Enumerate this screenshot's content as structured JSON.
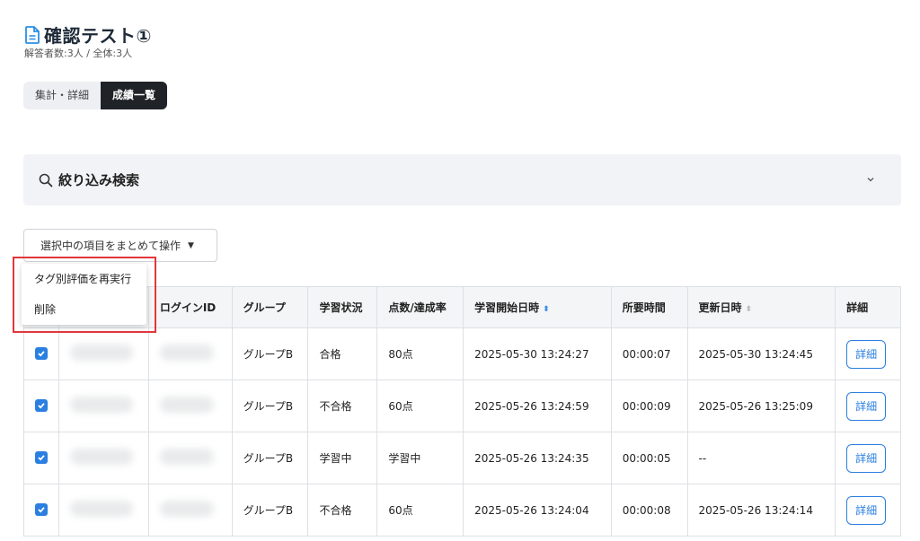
{
  "header": {
    "title": "確認テスト①",
    "subtitle": "解答者数:3人 / 全体:3人"
  },
  "tabs": [
    {
      "label": "集計・詳細",
      "active": false
    },
    {
      "label": "成績一覧",
      "active": true
    }
  ],
  "filter": {
    "label": "絞り込み検索"
  },
  "bulk_action": {
    "label": "選択中の項目をまとめて操作",
    "menu": [
      "タグ別評価を再実行",
      "削除"
    ]
  },
  "table": {
    "headers": [
      "",
      "",
      "ログインID",
      "グループ",
      "学習状況",
      "点数/達成率",
      "学習開始日時",
      "所要時間",
      "更新日時",
      "詳細"
    ],
    "rows": [
      {
        "group": "グループB",
        "status": "合格",
        "score": "80点",
        "start": "2025-05-30 13:24:27",
        "duration": "00:00:07",
        "updated": "2025-05-30 13:24:45",
        "detail": "詳細"
      },
      {
        "group": "グループB",
        "status": "不合格",
        "score": "60点",
        "start": "2025-05-26 13:24:59",
        "duration": "00:00:09",
        "updated": "2025-05-26 13:25:09",
        "detail": "詳細"
      },
      {
        "group": "グループB",
        "status": "学習中",
        "score": "学習中",
        "start": "2025-05-26 13:24:35",
        "duration": "00:00:05",
        "updated": "--",
        "detail": "詳細"
      },
      {
        "group": "グループB",
        "status": "不合格",
        "score": "60点",
        "start": "2025-05-26 13:24:04",
        "duration": "00:00:08",
        "updated": "2025-05-26 13:24:14",
        "detail": "詳細"
      }
    ]
  },
  "colors": {
    "accent": "#2b7fe0",
    "active_tab": "#1f2328",
    "highlight": "#e0373b"
  },
  "icons": [
    "document-icon",
    "search-icon",
    "chevron-down-icon",
    "caret-down-icon",
    "checkbox-checked-icon",
    "sort-icon"
  ]
}
